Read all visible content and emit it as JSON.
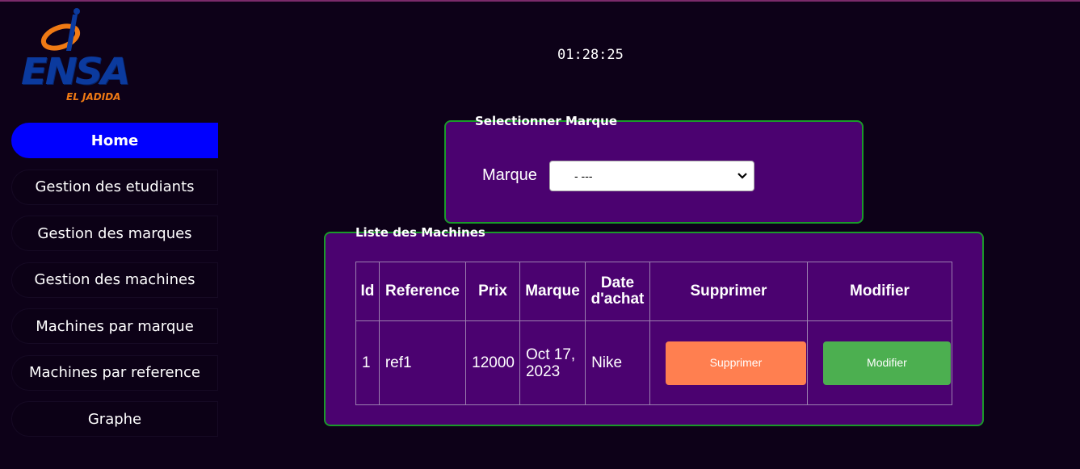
{
  "logo": {
    "name": "ENSA",
    "city": "EL JADIDA"
  },
  "clock": "01:28:25",
  "nav": {
    "items": [
      {
        "label": "Home",
        "active": true
      },
      {
        "label": "Gestion des etudiants"
      },
      {
        "label": "Gestion des marques"
      },
      {
        "label": "Gestion des machines"
      },
      {
        "label": "Machines par marque"
      },
      {
        "label": "Machines par reference"
      },
      {
        "label": "Graphe"
      }
    ]
  },
  "marque_panel": {
    "legend": "Selectionner Marque",
    "label": "Marque",
    "selected": "- ---"
  },
  "list_panel": {
    "legend": "Liste des Machines",
    "headers": [
      "Id",
      "Reference",
      "Prix",
      "Marque",
      "Date d'achat",
      "Supprimer",
      "Modifier"
    ],
    "rows": [
      {
        "id": "1",
        "reference": "ref1",
        "prix": "12000",
        "date": "Oct 17, 2023",
        "marque": "Nike",
        "delete_label": "Supprimer",
        "edit_label": "Modifier"
      }
    ]
  },
  "colors": {
    "background": "#0d0118",
    "panel": "#4b0270",
    "panel_border": "#1a9a2a",
    "nav_active": "#0000ff",
    "delete_button": "#ff7f50",
    "edit_button": "#4caf50"
  }
}
